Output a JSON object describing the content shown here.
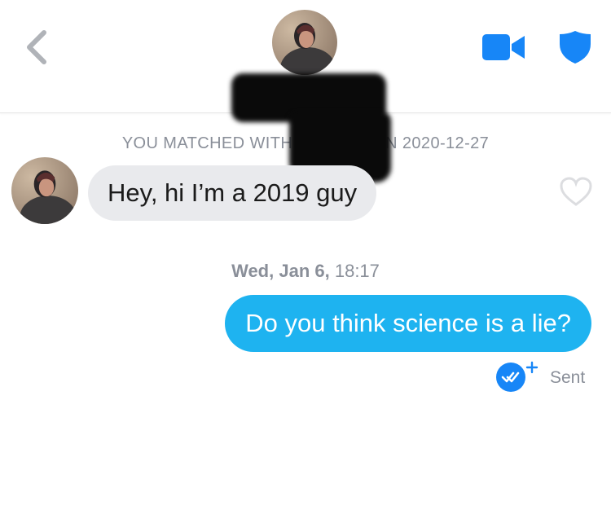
{
  "header": {
    "back_icon": "chevron-left-icon",
    "video_icon": "video-camera-icon",
    "safety_icon": "shield-icon",
    "accent_color": "#1786F7"
  },
  "conversation": {
    "match_notice": "YOU MATCHED WITH HA[redacted] ON 2020-12-27",
    "match_notice_prefix": "YOU MATCHED WITH ",
    "match_notice_suffix": "ON 2020-12-27",
    "incoming": {
      "text": "Hey, hi I’m a 2019 guy",
      "like_icon": "heart-outline-icon"
    },
    "timestamp": {
      "day": "Wed, Jan 6,",
      "time": "18:17"
    },
    "outgoing": {
      "text": "Do you think science is a lie?",
      "bubble_color": "#1EB3F0",
      "receipt_icon": "double-check-plus-icon",
      "status": "Sent"
    }
  }
}
